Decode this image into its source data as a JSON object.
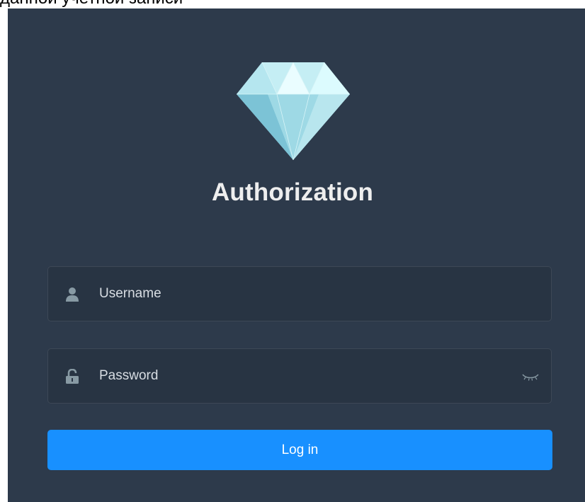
{
  "document": {
    "caption_fragment": "данной учетной записи"
  },
  "login": {
    "title": "Authorization",
    "username": {
      "placeholder": "Username",
      "value": "",
      "icon": "user-icon"
    },
    "password": {
      "placeholder": "Password",
      "value": "",
      "icon": "lock-icon",
      "visibility_icon": "eye-closed-icon"
    },
    "submit_label": "Log in",
    "logo_icon": "diamond-logo"
  },
  "colors": {
    "panel_background": "#2d3a4b",
    "field_background": "#283443",
    "accent": "#1890ff",
    "title_text": "#eeeeee",
    "logo_light": "#dcfbfe",
    "logo_mid": "#a9e0eb",
    "logo_dark": "#7cc3d6"
  }
}
